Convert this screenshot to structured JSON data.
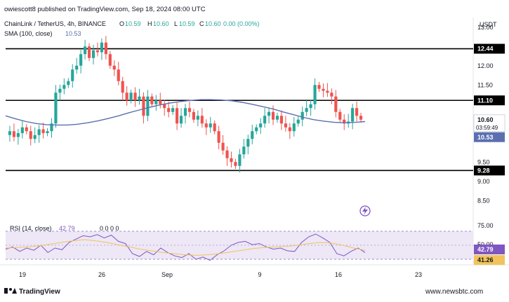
{
  "header": {
    "published": "owiescott8 published on TradingView.com, Sep 18, 2024 08:00 UTC",
    "symbol": "ChainLink / TetherUS, 4h, BINANCE",
    "ohlc": {
      "o_label": "O",
      "o_value": "10.59",
      "h_label": "H",
      "h_value": "10.60",
      "l_label": "L",
      "l_value": "10.59",
      "c_label": "C",
      "c_value": "10.60",
      "change": "0.00 (0.00%)"
    },
    "sma_label": "SMA (100, close)",
    "sma_value": "10.53",
    "currency": "USDT"
  },
  "footer": {
    "logo_text": "TradingView",
    "watermark": "www.newsbtc.com"
  },
  "colors": {
    "up": "#26a69a",
    "down": "#ef5350",
    "sma": "#5b6fb0",
    "rsi": "#7e57c2",
    "rsi_ma": "#f2c35a",
    "level": "#000000",
    "rsi_band": "#ede7f6"
  },
  "chart_data": {
    "type": "candlestick",
    "price_axis": {
      "ticks": [
        "13.00",
        "12.44",
        "12.00",
        "11.50",
        "11.10",
        "10.60",
        "10.53",
        "9.50",
        "9.28",
        "9.00",
        "8.50"
      ],
      "ylim": [
        8.25,
        13.25
      ]
    },
    "time_axis": {
      "ticks": [
        "19",
        "26",
        "Sep",
        "9",
        "16",
        "23"
      ]
    },
    "horizontal_levels": [
      {
        "label": "12.44",
        "value": 12.44
      },
      {
        "label": "11.10",
        "value": 11.1
      },
      {
        "label": "9.28",
        "value": 9.28
      }
    ],
    "last_price": {
      "label": "10.60",
      "value": 10.6
    },
    "countdown": "03:59:49",
    "sma_last": {
      "label": "10.53",
      "value": 10.53
    },
    "price_series": [
      10.2,
      10.3,
      10.15,
      10.25,
      10.4,
      10.3,
      10.1,
      10.2,
      10.35,
      10.25,
      10.3,
      10.5,
      11.3,
      11.4,
      11.5,
      11.6,
      11.9,
      12.0,
      12.3,
      12.5,
      12.2,
      12.4,
      12.35,
      12.6,
      12.3,
      12.0,
      11.9,
      11.6,
      11.3,
      11.1,
      11.3,
      11.1,
      11.2,
      10.7,
      11.2,
      11.0,
      11.1,
      11.0,
      10.9,
      10.8,
      10.9,
      10.5,
      10.7,
      10.9,
      10.8,
      10.6,
      10.7,
      10.5,
      10.4,
      10.5,
      10.3,
      10.0,
      9.8,
      9.6,
      9.5,
      9.4,
      9.7,
      9.9,
      10.1,
      10.3,
      10.4,
      10.5,
      10.7,
      10.8,
      10.6,
      10.7,
      10.5,
      10.4,
      10.3,
      10.5,
      10.6,
      10.8,
      10.9,
      11.0,
      11.5,
      11.4,
      11.35,
      11.3,
      11.2,
      10.8,
      10.6,
      10.5,
      10.55,
      10.9,
      10.7,
      10.6
    ],
    "sma_series": [
      10.7,
      10.62,
      10.55,
      10.5,
      10.47,
      10.46,
      10.46,
      10.48,
      10.52,
      10.57,
      10.63,
      10.7,
      10.78,
      10.85,
      10.92,
      10.98,
      11.03,
      11.07,
      11.1,
      11.12,
      11.12,
      11.11,
      11.09,
      11.05,
      11.0,
      10.94,
      10.88,
      10.8,
      10.73,
      10.66,
      10.6,
      10.56,
      10.53,
      10.52,
      10.53,
      10.55
    ],
    "rsi": {
      "label": "RSI (14, close)",
      "value_label": "42.79",
      "extra_label": "0 0 0 0",
      "ticks": [
        "75.00",
        "50.00"
      ],
      "upper": 70,
      "lower": 30,
      "rsi_value": {
        "label": "42.79",
        "value": 42.79
      },
      "rsi_ma_value": {
        "label": "41.26",
        "value": 41.26
      },
      "series": [
        48,
        52,
        44,
        50,
        46,
        55,
        42,
        50,
        47,
        60,
        66,
        72,
        70,
        74,
        68,
        73,
        62,
        58,
        40,
        35,
        44,
        38,
        50,
        42,
        36,
        33,
        40,
        30,
        34,
        28,
        38,
        45,
        55,
        60,
        62,
        56,
        58,
        52,
        48,
        50,
        45,
        44,
        60,
        70,
        75,
        68,
        60,
        40,
        36,
        44,
        50,
        42
      ],
      "ma_series": [
        50,
        51,
        52,
        54,
        57,
        60,
        63,
        65,
        63,
        60,
        56,
        52,
        48,
        45,
        42,
        40,
        38,
        37,
        38,
        40,
        43,
        46,
        49,
        51,
        52,
        53,
        55,
        58,
        60,
        59,
        55,
        50,
        46
      ]
    }
  }
}
